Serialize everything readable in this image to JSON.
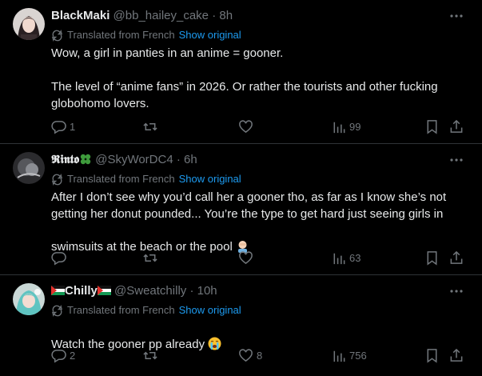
{
  "tweets": [
    {
      "name": "BlackMaki",
      "handle": "@bb_hailey_cake",
      "sep": "·",
      "time": "8h",
      "translated_label": "Translated from French",
      "show_original": "Show original",
      "body": "Wow, a girl in panties in an anime = gooner.\n\nThe level of “anime fans” in 2026. Or rather the tourists and other fucking globohomo lovers.",
      "replies": "1",
      "retweets": "",
      "likes": "",
      "views": "99"
    },
    {
      "name": "𝕽𝖎𝖓𝖙𝖔",
      "name_emoji": "🍀",
      "handle": "@SkyWorDC4",
      "sep": "·",
      "time": "6h",
      "translated_label": "Translated from French",
      "show_original": "Show original",
      "body": "After I don’t see why you’d call her a gooner tho, as far as I know she’s not getting her donut pounded... You’re the type to get hard just seeing girls in swimsuits at the beach or the pool",
      "body_emoji": "🤦🏻‍♂️",
      "replies": "",
      "retweets": "",
      "likes": "",
      "views": "63"
    },
    {
      "name": "Chilly",
      "name_flag": "🇵🇸",
      "handle": "@Sweatchilly",
      "sep": "·",
      "time": "10h",
      "translated_label": "Translated from French",
      "show_original": "Show original",
      "body": "Watch the gooner pp already",
      "body_emoji": "😭",
      "replies": "2",
      "retweets": "",
      "likes": "8",
      "views": "756"
    }
  ],
  "colors": {
    "background": "#000000",
    "text": "#e7e9ea",
    "muted": "#71767b",
    "link": "#1d9bf0",
    "divider": "#2f3336"
  }
}
